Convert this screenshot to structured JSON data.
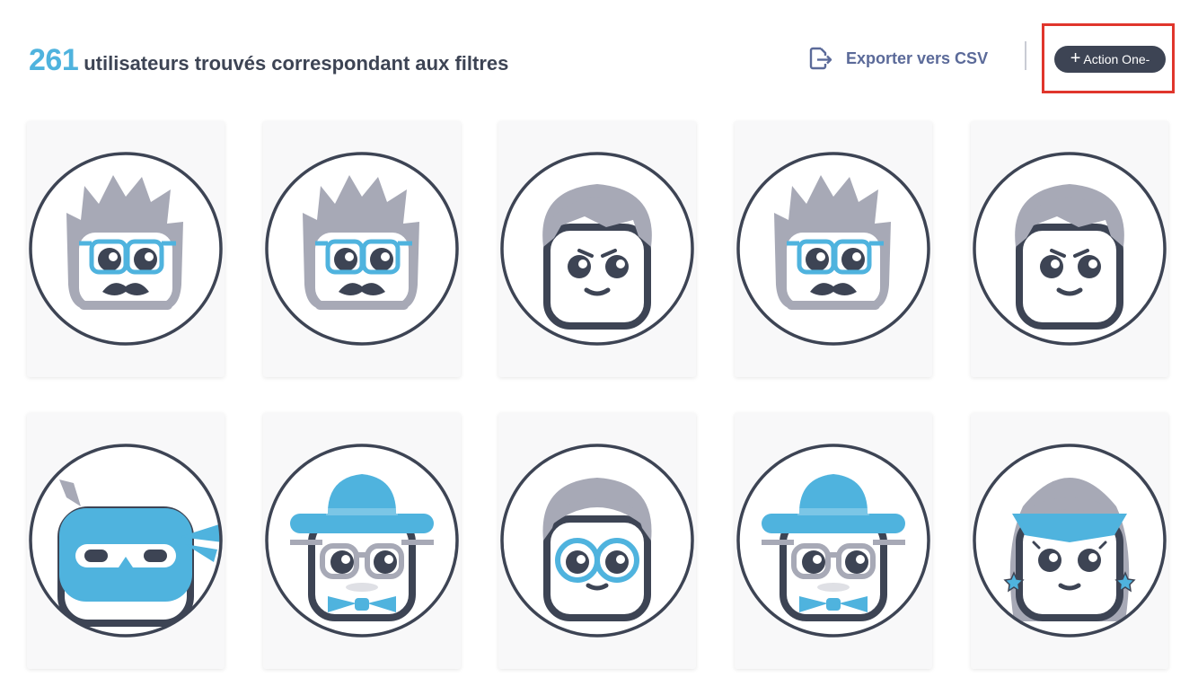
{
  "header": {
    "count": "261",
    "title": "utilisateurs trouvés correspondant aux filtres"
  },
  "toolbar": {
    "export_label": "Exporter vers CSV",
    "export_icon": "export-icon",
    "action_plus": "+",
    "action_label": "Action One-"
  },
  "colors": {
    "accent": "#4fb3de",
    "dark": "#3d4454",
    "gray_hair": "#a7a9b6",
    "export_text": "#5b6a99",
    "highlight": "#e0362c"
  },
  "users": [
    {
      "avatar": "mustache-glasses"
    },
    {
      "avatar": "mustache-glasses"
    },
    {
      "avatar": "angry-boy"
    },
    {
      "avatar": "mustache-glasses"
    },
    {
      "avatar": "angry-boy"
    },
    {
      "avatar": "ninja"
    },
    {
      "avatar": "hat-bowtie"
    },
    {
      "avatar": "round-glasses"
    },
    {
      "avatar": "hat-bowtie"
    },
    {
      "avatar": "star-girl"
    }
  ]
}
